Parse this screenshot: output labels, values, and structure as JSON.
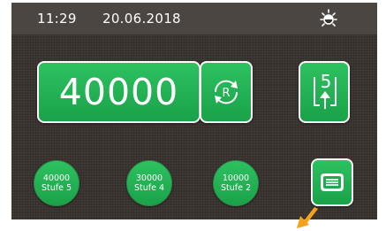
{
  "status": {
    "time": "11:29",
    "date": "20.06.2018",
    "brightness_icon": "sun-icon"
  },
  "main": {
    "counter_value": "40000",
    "reset_icon": "refresh-r-icon",
    "level_icon": "level-up-5-icon",
    "level_number": "5",
    "reset_letter": "R"
  },
  "presets": [
    {
      "value": "40000",
      "label": "Stufe 5"
    },
    {
      "value": "30000",
      "label": "Stufe 4"
    },
    {
      "value": "10000",
      "label": "Stufe 2"
    }
  ],
  "menu": {
    "icon": "menu-list-icon"
  },
  "colors": {
    "button_green": "#22b154",
    "background": "#3a3430",
    "pointer_orange": "#f5a21b"
  }
}
